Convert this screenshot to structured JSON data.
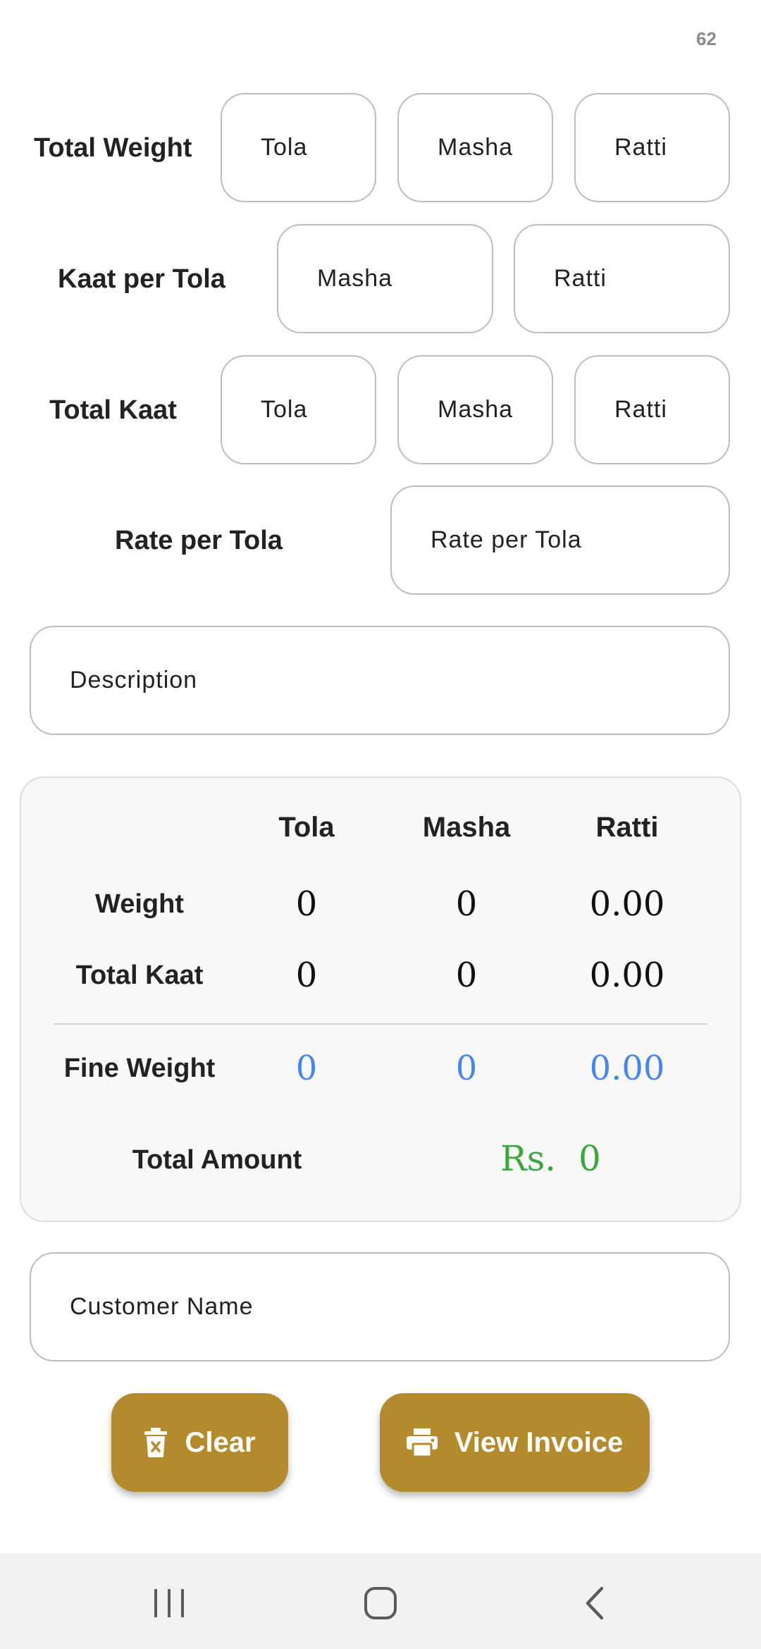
{
  "status": {
    "number": "62"
  },
  "inputs": {
    "total_weight": {
      "label": "Total Weight",
      "tola": "Tola",
      "masha": "Masha",
      "ratti": "Ratti"
    },
    "kaat_per_tola": {
      "label": "Kaat per Tola",
      "masha": "Masha",
      "ratti": "Ratti"
    },
    "total_kaat": {
      "label": "Total Kaat",
      "tola": "Tola",
      "masha": "Masha",
      "ratti": "Ratti"
    },
    "rate_per_tola": {
      "label": "Rate per Tola",
      "placeholder": "Rate per Tola"
    },
    "description": {
      "placeholder": "Description"
    },
    "customer_name": {
      "placeholder": "Customer Name"
    }
  },
  "summary": {
    "headers": {
      "tola": "Tola",
      "masha": "Masha",
      "ratti": "Ratti"
    },
    "weight": {
      "label": "Weight",
      "tola": "0",
      "masha": "0",
      "ratti": "0.00"
    },
    "total_kaat": {
      "label": "Total Kaat",
      "tola": "0",
      "masha": "0",
      "ratti": "0.00"
    },
    "fine_weight": {
      "label": "Fine Weight",
      "tola": "0",
      "masha": "0",
      "ratti": "0.00"
    },
    "total_amount": {
      "label": "Total Amount",
      "value": "Rs.  0"
    }
  },
  "actions": {
    "clear": "Clear",
    "view_invoice": "View Invoice"
  },
  "icons": {
    "clear": "trash-icon",
    "view_invoice": "printer-icon",
    "nav_recent": "recent-apps-icon",
    "nav_home": "home-icon",
    "nav_back": "back-icon"
  },
  "colors": {
    "accent": "#b38b2e",
    "fine_weight": "#4a86e8",
    "amount": "#3da63d"
  }
}
